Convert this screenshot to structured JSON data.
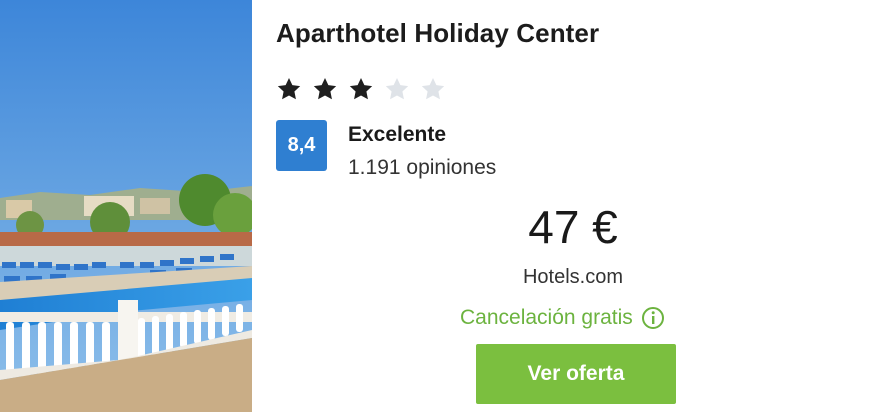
{
  "hotel": {
    "name": "Aparthotel Holiday Center",
    "stars": {
      "filled": 3,
      "total": 5
    },
    "rating": {
      "score": "8,4",
      "label": "Excelente",
      "reviews": "1.191 opiniones"
    }
  },
  "offer": {
    "price": "47 €",
    "provider": "Hotels.com",
    "cancellation": "Cancelación gratis",
    "cta_label": "Ver oferta"
  },
  "icons": {
    "stars": "star-icon",
    "info": "info-icon"
  },
  "colors": {
    "rating_badge": "#2f7fd1",
    "cancellation_text": "#6cb33f",
    "cta_button": "#7bbf3f",
    "star_filled": "#1f1f1f",
    "star_empty": "#dfe3e8"
  }
}
